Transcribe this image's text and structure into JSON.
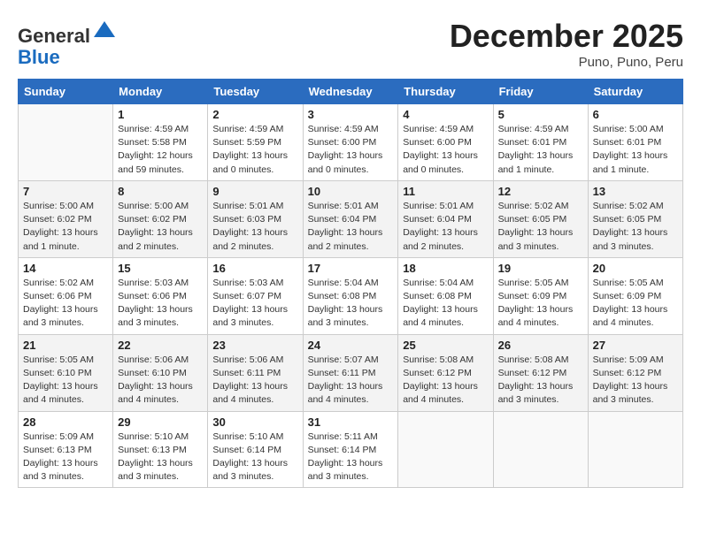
{
  "header": {
    "logo_general": "General",
    "logo_blue": "Blue",
    "month": "December 2025",
    "location": "Puno, Puno, Peru"
  },
  "weekdays": [
    "Sunday",
    "Monday",
    "Tuesday",
    "Wednesday",
    "Thursday",
    "Friday",
    "Saturday"
  ],
  "weeks": [
    [
      {
        "day": "",
        "info": ""
      },
      {
        "day": "1",
        "info": "Sunrise: 4:59 AM\nSunset: 5:58 PM\nDaylight: 12 hours\nand 59 minutes."
      },
      {
        "day": "2",
        "info": "Sunrise: 4:59 AM\nSunset: 5:59 PM\nDaylight: 13 hours\nand 0 minutes."
      },
      {
        "day": "3",
        "info": "Sunrise: 4:59 AM\nSunset: 6:00 PM\nDaylight: 13 hours\nand 0 minutes."
      },
      {
        "day": "4",
        "info": "Sunrise: 4:59 AM\nSunset: 6:00 PM\nDaylight: 13 hours\nand 0 minutes."
      },
      {
        "day": "5",
        "info": "Sunrise: 4:59 AM\nSunset: 6:01 PM\nDaylight: 13 hours\nand 1 minute."
      },
      {
        "day": "6",
        "info": "Sunrise: 5:00 AM\nSunset: 6:01 PM\nDaylight: 13 hours\nand 1 minute."
      }
    ],
    [
      {
        "day": "7",
        "info": "Sunrise: 5:00 AM\nSunset: 6:02 PM\nDaylight: 13 hours\nand 1 minute."
      },
      {
        "day": "8",
        "info": "Sunrise: 5:00 AM\nSunset: 6:02 PM\nDaylight: 13 hours\nand 2 minutes."
      },
      {
        "day": "9",
        "info": "Sunrise: 5:01 AM\nSunset: 6:03 PM\nDaylight: 13 hours\nand 2 minutes."
      },
      {
        "day": "10",
        "info": "Sunrise: 5:01 AM\nSunset: 6:04 PM\nDaylight: 13 hours\nand 2 minutes."
      },
      {
        "day": "11",
        "info": "Sunrise: 5:01 AM\nSunset: 6:04 PM\nDaylight: 13 hours\nand 2 minutes."
      },
      {
        "day": "12",
        "info": "Sunrise: 5:02 AM\nSunset: 6:05 PM\nDaylight: 13 hours\nand 3 minutes."
      },
      {
        "day": "13",
        "info": "Sunrise: 5:02 AM\nSunset: 6:05 PM\nDaylight: 13 hours\nand 3 minutes."
      }
    ],
    [
      {
        "day": "14",
        "info": "Sunrise: 5:02 AM\nSunset: 6:06 PM\nDaylight: 13 hours\nand 3 minutes."
      },
      {
        "day": "15",
        "info": "Sunrise: 5:03 AM\nSunset: 6:06 PM\nDaylight: 13 hours\nand 3 minutes."
      },
      {
        "day": "16",
        "info": "Sunrise: 5:03 AM\nSunset: 6:07 PM\nDaylight: 13 hours\nand 3 minutes."
      },
      {
        "day": "17",
        "info": "Sunrise: 5:04 AM\nSunset: 6:08 PM\nDaylight: 13 hours\nand 3 minutes."
      },
      {
        "day": "18",
        "info": "Sunrise: 5:04 AM\nSunset: 6:08 PM\nDaylight: 13 hours\nand 4 minutes."
      },
      {
        "day": "19",
        "info": "Sunrise: 5:05 AM\nSunset: 6:09 PM\nDaylight: 13 hours\nand 4 minutes."
      },
      {
        "day": "20",
        "info": "Sunrise: 5:05 AM\nSunset: 6:09 PM\nDaylight: 13 hours\nand 4 minutes."
      }
    ],
    [
      {
        "day": "21",
        "info": "Sunrise: 5:05 AM\nSunset: 6:10 PM\nDaylight: 13 hours\nand 4 minutes."
      },
      {
        "day": "22",
        "info": "Sunrise: 5:06 AM\nSunset: 6:10 PM\nDaylight: 13 hours\nand 4 minutes."
      },
      {
        "day": "23",
        "info": "Sunrise: 5:06 AM\nSunset: 6:11 PM\nDaylight: 13 hours\nand 4 minutes."
      },
      {
        "day": "24",
        "info": "Sunrise: 5:07 AM\nSunset: 6:11 PM\nDaylight: 13 hours\nand 4 minutes."
      },
      {
        "day": "25",
        "info": "Sunrise: 5:08 AM\nSunset: 6:12 PM\nDaylight: 13 hours\nand 4 minutes."
      },
      {
        "day": "26",
        "info": "Sunrise: 5:08 AM\nSunset: 6:12 PM\nDaylight: 13 hours\nand 3 minutes."
      },
      {
        "day": "27",
        "info": "Sunrise: 5:09 AM\nSunset: 6:12 PM\nDaylight: 13 hours\nand 3 minutes."
      }
    ],
    [
      {
        "day": "28",
        "info": "Sunrise: 5:09 AM\nSunset: 6:13 PM\nDaylight: 13 hours\nand 3 minutes."
      },
      {
        "day": "29",
        "info": "Sunrise: 5:10 AM\nSunset: 6:13 PM\nDaylight: 13 hours\nand 3 minutes."
      },
      {
        "day": "30",
        "info": "Sunrise: 5:10 AM\nSunset: 6:14 PM\nDaylight: 13 hours\nand 3 minutes."
      },
      {
        "day": "31",
        "info": "Sunrise: 5:11 AM\nSunset: 6:14 PM\nDaylight: 13 hours\nand 3 minutes."
      },
      {
        "day": "",
        "info": ""
      },
      {
        "day": "",
        "info": ""
      },
      {
        "day": "",
        "info": ""
      }
    ]
  ]
}
